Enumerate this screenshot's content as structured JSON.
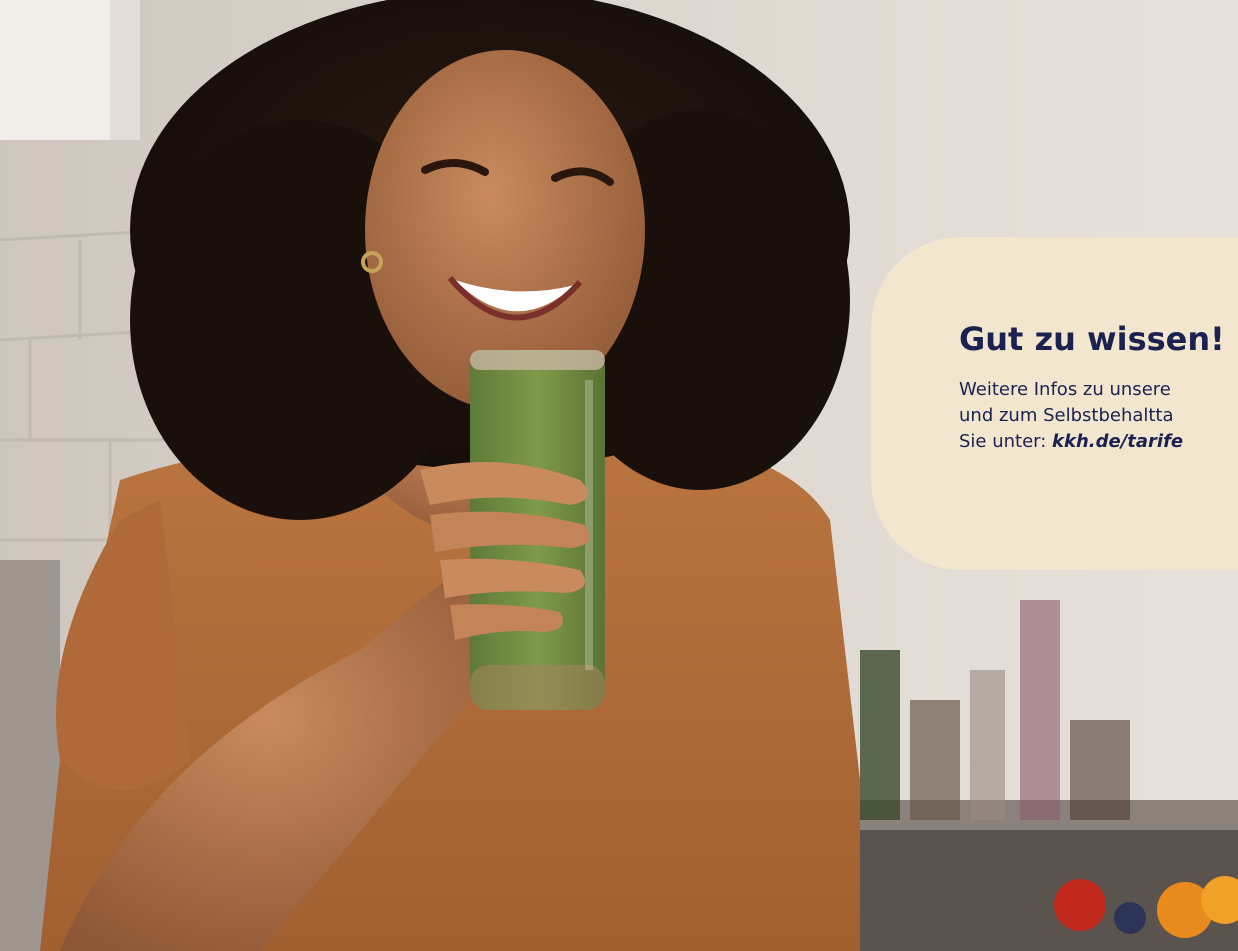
{
  "info_box": {
    "title": "Gut zu wissen!",
    "line1": "Weitere Infos zu unsere",
    "line2": "und zum Selbstbehaltta",
    "line3_prefix": "Sie unter: ",
    "link_text": "kkh.de/tarife"
  },
  "colors": {
    "card_background": "#f3e6cf",
    "text": "#1b2150"
  }
}
